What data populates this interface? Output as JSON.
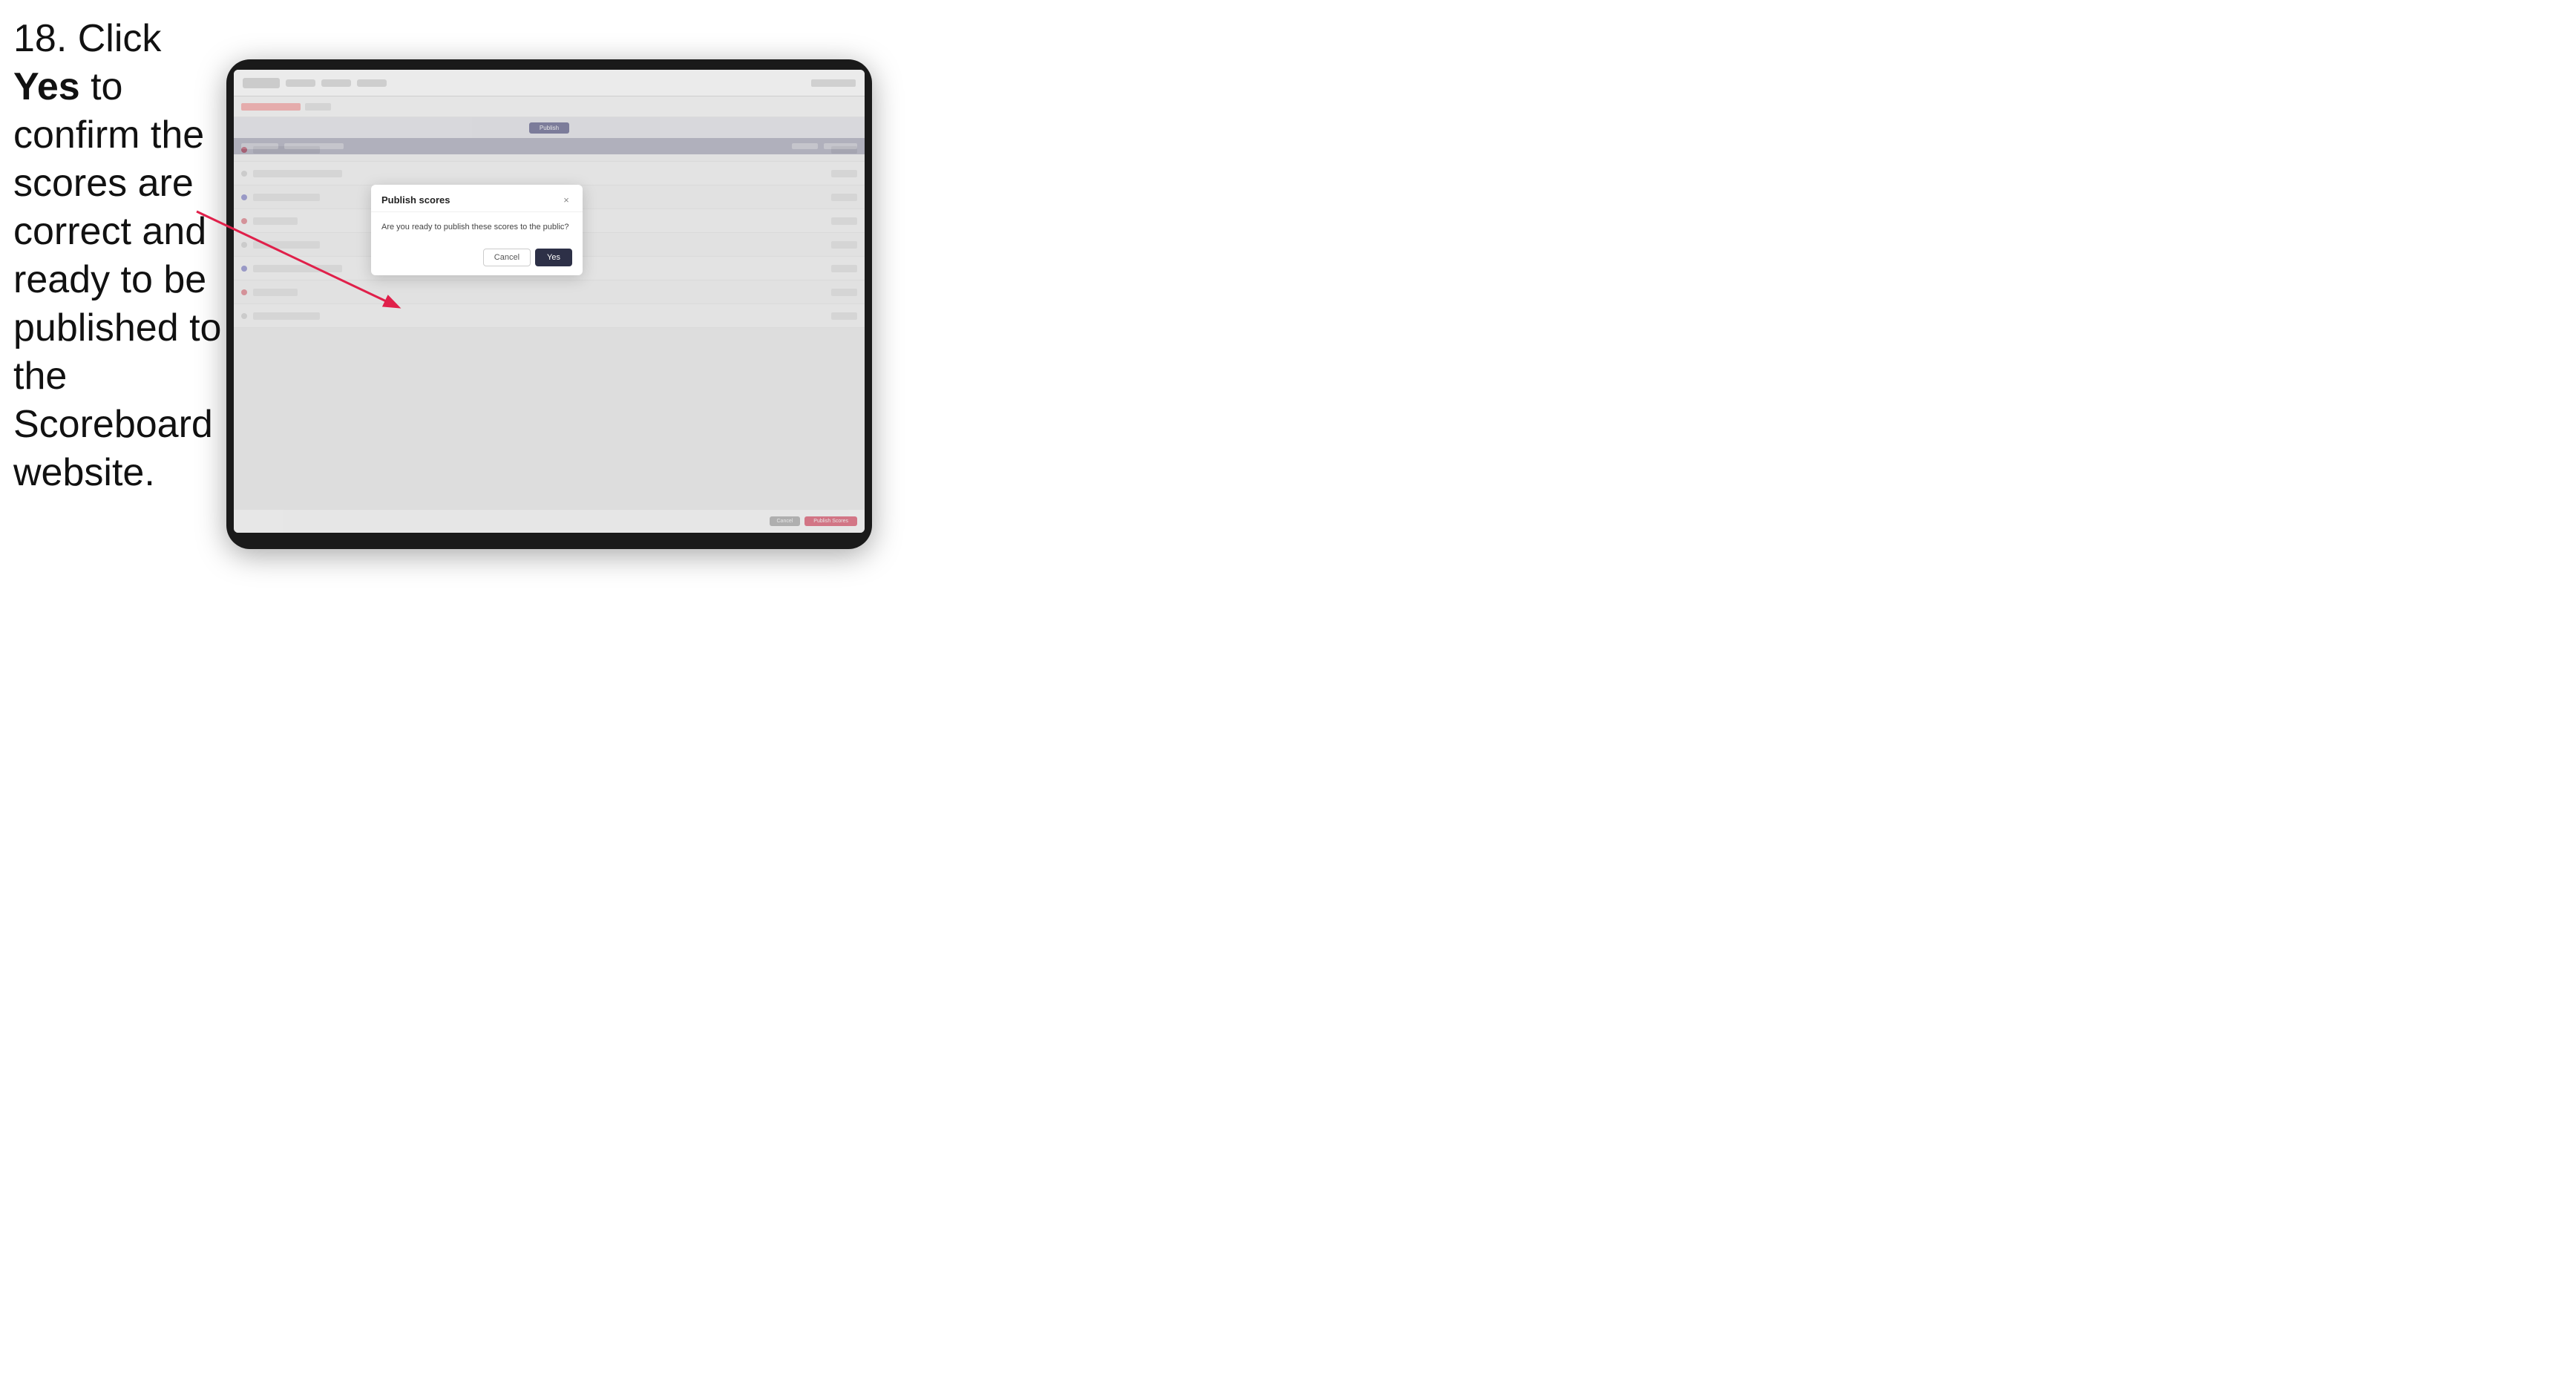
{
  "instruction": {
    "step_number": "18.",
    "text_before_bold": " Click ",
    "bold_text": "Yes",
    "text_after": " to confirm the scores are correct and ready to be published to the Scoreboard website."
  },
  "tablet": {
    "app": {
      "header": {
        "logo_placeholder": "logo"
      },
      "toolbar": {
        "button_label": "Publish"
      }
    }
  },
  "modal": {
    "title": "Publish scores",
    "message": "Are you ready to publish these scores to the public?",
    "cancel_label": "Cancel",
    "yes_label": "Yes",
    "close_aria": "×"
  },
  "arrow": {
    "description": "red arrow pointing to modal"
  }
}
